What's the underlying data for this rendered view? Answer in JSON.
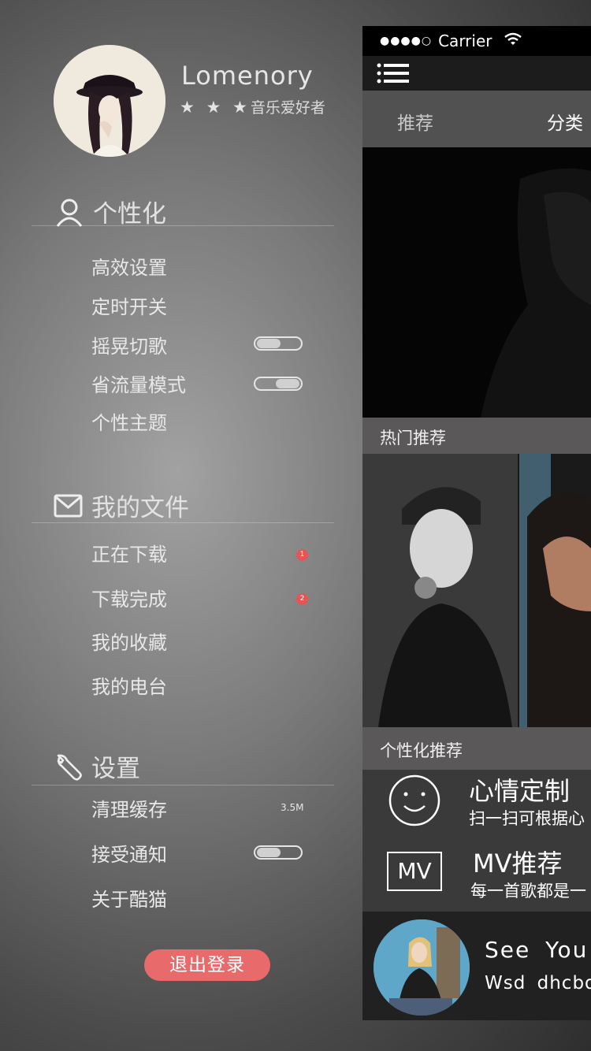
{
  "profile": {
    "username": "Lomenory",
    "stars": "★ ★ ★",
    "title": "音乐爱好者"
  },
  "sections": {
    "personalize": {
      "label": "个性化",
      "items": [
        "高效设置",
        "定时开关",
        "摇晃切歌",
        "省流量模式",
        "个性主题"
      ]
    },
    "files": {
      "label": "我的文件",
      "items": [
        "正在下载",
        "下载完成",
        "我的收藏",
        "我的电台"
      ],
      "badges": [
        "1",
        "2"
      ]
    },
    "settings": {
      "label": "设置",
      "items": [
        "清理缓存",
        "接受通知",
        "关于酷猫"
      ],
      "cache_size": "3.5M"
    }
  },
  "toggles": {
    "shake_switch": "off",
    "data_saver": "on",
    "notifications": "off"
  },
  "logout_label": "退出登录",
  "main": {
    "status": {
      "dots": "●●●●○",
      "carrier": "Carrier"
    },
    "tabs": [
      "推荐",
      "分类"
    ],
    "hot_label": "热门推荐",
    "personal_label": "个性化推荐",
    "recs": [
      {
        "title": "心情定制",
        "sub": "扫一扫可根据心"
      },
      {
        "title": "MV推荐",
        "sub": "每一首歌都是一",
        "icon_text": "MV"
      }
    ],
    "now_playing": {
      "song": "See You A",
      "artist": "Wsd dhcbdr"
    }
  },
  "colors": {
    "accent": "#e86a6a",
    "badge": "#e75454"
  }
}
